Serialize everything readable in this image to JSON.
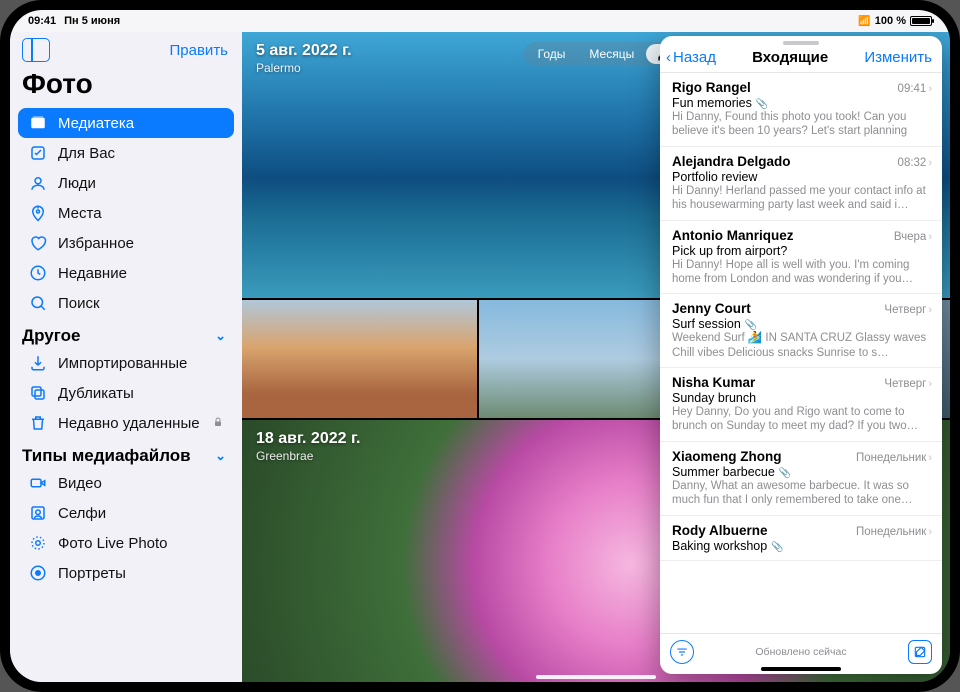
{
  "status": {
    "time": "09:41",
    "date": "Пн 5 июня",
    "battery": "100 %"
  },
  "sidebar": {
    "edit": "Править",
    "title": "Фото",
    "items": [
      {
        "label": "Медиатека",
        "icon": "library-icon",
        "active": true
      },
      {
        "label": "Для Вас",
        "icon": "foryou-icon"
      },
      {
        "label": "Люди",
        "icon": "people-icon"
      },
      {
        "label": "Места",
        "icon": "places-icon"
      },
      {
        "label": "Избранное",
        "icon": "heart-icon"
      },
      {
        "label": "Недавние",
        "icon": "clock-icon"
      },
      {
        "label": "Поиск",
        "icon": "search-icon"
      }
    ],
    "section_other": "Другое",
    "other": [
      {
        "label": "Импортированные",
        "icon": "import-icon"
      },
      {
        "label": "Дубликаты",
        "icon": "duplicates-icon"
      },
      {
        "label": "Недавно удаленные",
        "icon": "trash-icon",
        "locked": true
      }
    ],
    "section_types": "Типы медиафайлов",
    "types": [
      {
        "label": "Видео",
        "icon": "video-icon"
      },
      {
        "label": "Селфи",
        "icon": "selfie-icon"
      },
      {
        "label": "Фото Live Photo",
        "icon": "livephoto-icon"
      },
      {
        "label": "Портреты",
        "icon": "portrait-icon"
      }
    ]
  },
  "content": {
    "group1": {
      "date": "5 авг. 2022 г.",
      "location": "Palermo"
    },
    "group2": {
      "date": "18 авг. 2022 г.",
      "location": "Greenbrae"
    },
    "segments": {
      "years": "Годы",
      "months": "Месяцы",
      "days": "Дн"
    }
  },
  "mail": {
    "back": "Назад",
    "title": "Входящие",
    "edit": "Изменить",
    "messages": [
      {
        "sender": "Rigo Rangel",
        "time": "09:41",
        "subject": "Fun memories",
        "preview": "Hi Danny, Found this photo you took! Can you believe it's been 10 years? Let's start planning",
        "clip": true
      },
      {
        "sender": "Alejandra Delgado",
        "time": "08:32",
        "subject": "Portfolio review",
        "preview": "Hi Danny! Herland passed me your contact info at his housewarming party last week and said i…"
      },
      {
        "sender": "Antonio Manriquez",
        "time": "Вчера",
        "subject": "Pick up from airport?",
        "preview": "Hi Danny! Hope all is well with you. I'm coming home from London and was wondering if you…"
      },
      {
        "sender": "Jenny Court",
        "time": "Четверг",
        "subject": "Surf session",
        "preview": "Weekend Surf 🏄 IN SANTA CRUZ Glassy waves Chill vibes Delicious snacks Sunrise to s…",
        "clip": true
      },
      {
        "sender": "Nisha Kumar",
        "time": "Четверг",
        "subject": "Sunday brunch",
        "preview": "Hey Danny, Do you and Rigo want to come to brunch on Sunday to meet my dad? If you two…"
      },
      {
        "sender": "Xiaomeng Zhong",
        "time": "Понедельник",
        "subject": "Summer barbecue",
        "preview": "Danny, What an awesome barbecue. It was so much fun that I only remembered to take one…",
        "clip": true
      },
      {
        "sender": "Rody Albuerne",
        "time": "Понедельник",
        "subject": "Baking workshop",
        "preview": "",
        "clip": true
      }
    ],
    "footer": "Обновлено сейчас"
  }
}
